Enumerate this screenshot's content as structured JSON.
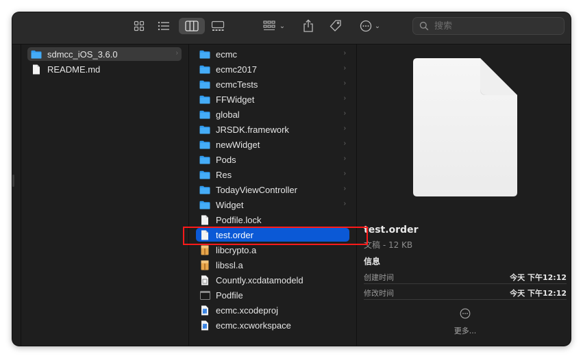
{
  "toolbar": {
    "search_placeholder": "搜索"
  },
  "column1": {
    "items": [
      {
        "label": "sdmcc_iOS_3.6.0",
        "kind": "folder",
        "has_children": true,
        "selected": "inactive"
      },
      {
        "label": "README.md",
        "kind": "file",
        "has_children": false
      }
    ]
  },
  "column2": {
    "items": [
      {
        "label": "ecmc",
        "kind": "folder",
        "has_children": true
      },
      {
        "label": "ecmc2017",
        "kind": "folder",
        "has_children": true
      },
      {
        "label": "ecmcTests",
        "kind": "folder",
        "has_children": true
      },
      {
        "label": "FFWidget",
        "kind": "folder",
        "has_children": true
      },
      {
        "label": "global",
        "kind": "folder",
        "has_children": true
      },
      {
        "label": "JRSDK.framework",
        "kind": "folder",
        "has_children": true
      },
      {
        "label": "newWidget",
        "kind": "folder",
        "has_children": true
      },
      {
        "label": "Pods",
        "kind": "folder",
        "has_children": true
      },
      {
        "label": "Res",
        "kind": "folder",
        "has_children": true
      },
      {
        "label": "TodayViewController",
        "kind": "folder",
        "has_children": true
      },
      {
        "label": "Widget",
        "kind": "folder",
        "has_children": true
      },
      {
        "label": "Podfile.lock",
        "kind": "file",
        "has_children": false
      },
      {
        "label": "test.order",
        "kind": "file",
        "has_children": false,
        "selected": "active"
      },
      {
        "label": "libcrypto.a",
        "kind": "archive",
        "has_children": false
      },
      {
        "label": "libssl.a",
        "kind": "archive",
        "has_children": false
      },
      {
        "label": "Countly.xcdatamodeld",
        "kind": "datamodel",
        "has_children": false
      },
      {
        "label": "Podfile",
        "kind": "exec",
        "has_children": false
      },
      {
        "label": "ecmc.xcodeproj",
        "kind": "xcode",
        "has_children": false
      },
      {
        "label": "ecmc.xcworkspace",
        "kind": "xcode",
        "has_children": false
      }
    ]
  },
  "preview": {
    "name": "test.order",
    "kind_size": "文稿 - 12 KB",
    "info_heading": "信息",
    "created_label": "创建时间",
    "created_value": "今天 下午12:12",
    "modified_label": "修改时间",
    "modified_value": "今天 下午12:12",
    "more_label": "更多..."
  },
  "colors": {
    "selection_active": "#0b59d6",
    "selection_inactive": "#3a3a3a",
    "folder_blue": "#2f9bf0",
    "highlight_red": "#ff1a1a"
  }
}
